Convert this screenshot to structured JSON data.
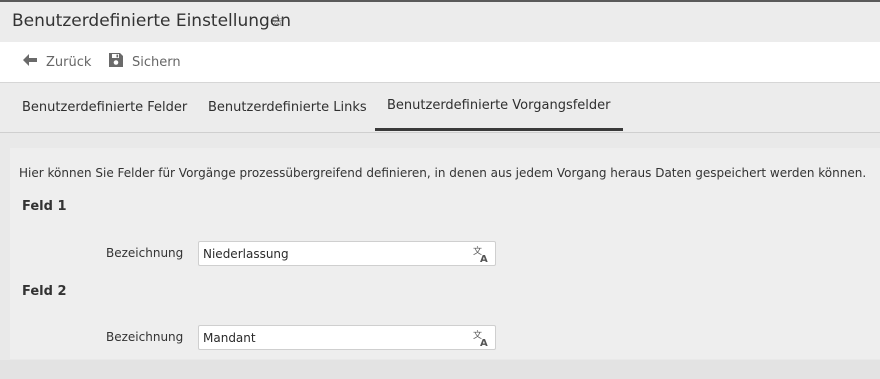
{
  "header": {
    "title": "Benutzerdefinierte Einstellungen",
    "favorite_icon": "star-outline-icon"
  },
  "toolbar": {
    "back_label": "Zurück",
    "back_icon": "arrow-left-icon",
    "save_label": "Sichern",
    "save_icon": "floppy-icon"
  },
  "tabs": [
    {
      "label": "Benutzerdefinierte Felder",
      "active": false
    },
    {
      "label": "Benutzerdefinierte Links",
      "active": false
    },
    {
      "label": "Benutzerdefinierte Vorgangsfelder",
      "active": true
    }
  ],
  "main": {
    "description": "Hier können Sie Felder für Vorgänge prozessübergreifend definieren, in denen aus jedem Vorgang heraus Daten gespeichert werden können.",
    "fields": [
      {
        "heading": "Feld 1",
        "label": "Bezeichnung",
        "value": "Niederlassung",
        "icon": "translate-icon"
      },
      {
        "heading": "Feld 2",
        "label": "Bezeichnung",
        "value": "Mandant",
        "icon": "translate-icon"
      }
    ]
  },
  "colors": {
    "background": "#e9e9e9",
    "toolbar": "#ffffff",
    "active_tab_underline": "#3a3a3a",
    "text": "#2b2b2b"
  }
}
